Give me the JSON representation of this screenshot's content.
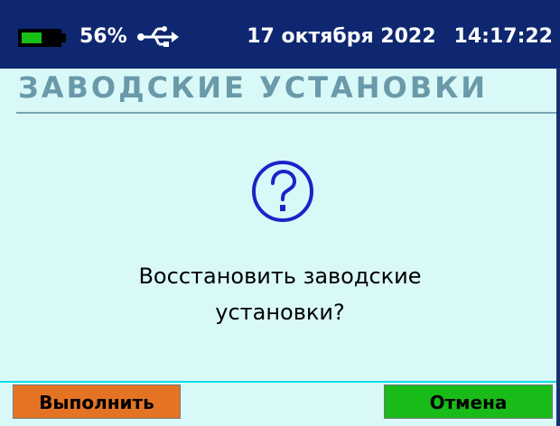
{
  "status_bar": {
    "battery_percent": "56%",
    "battery_level": 0.56,
    "usb_icon": "usb-icon",
    "date": "17 октября 2022",
    "time": "14:17:22"
  },
  "header": {
    "title": "ЗАВОДСКИЕ УСТАНОВКИ"
  },
  "dialog": {
    "icon": "question-circle-icon",
    "message_line1": "Восстановить заводские",
    "message_line2": "установки?"
  },
  "buttons": {
    "execute_label": "Выполнить",
    "cancel_label": "Отмена"
  },
  "colors": {
    "status_bar_bg": "#0e2770",
    "screen_bg": "#d9f8f8",
    "title_color": "#6a9aaa",
    "question_icon": "#1a24c8",
    "execute_button": "#e47424",
    "cancel_button": "#18bb18",
    "battery_fill": "#18c018"
  }
}
